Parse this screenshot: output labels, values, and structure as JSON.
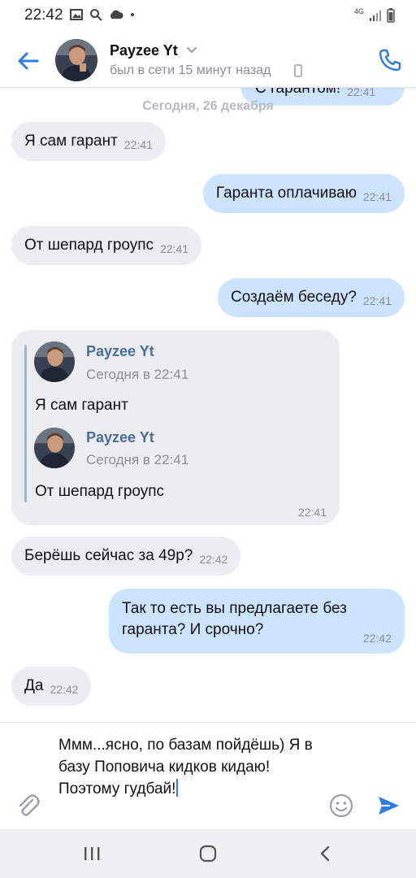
{
  "status_bar": {
    "time": "22:42",
    "network": "4G"
  },
  "header": {
    "name": "Payzee Yt",
    "status": "был в сети 15 минут назад"
  },
  "chat": {
    "partial_message": {
      "text": "С гарантом!",
      "time": "22:41"
    },
    "date_separator": "Сегодня, 26 декабря",
    "messages": [
      {
        "dir": "in",
        "text": "Я сам гарант",
        "time": "22:41"
      },
      {
        "dir": "out",
        "text": "Гаранта оплачиваю",
        "time": "22:41"
      },
      {
        "dir": "in",
        "text": "От шепард гроупс",
        "time": "22:41"
      },
      {
        "dir": "out",
        "text": "Создаём беседу?",
        "time": "22:41"
      }
    ],
    "forwarded": {
      "time": "22:41",
      "items": [
        {
          "author": "Payzee Yt",
          "date": "Сегодня в 22:41",
          "text": "Я сам гарант"
        },
        {
          "author": "Payzee Yt",
          "date": "Сегодня в 22:41",
          "text": "От шепард гроупс"
        }
      ]
    },
    "messages_after": [
      {
        "dir": "in",
        "text": "Берёшь сейчас за 49р?",
        "time": "22:42"
      },
      {
        "dir": "out",
        "text": "Так то есть вы предлагаете без гаранта? И срочно?",
        "time": "22:42"
      },
      {
        "dir": "in",
        "text": "Да",
        "time": "22:42"
      }
    ]
  },
  "composer": {
    "value": "Ммм...ясно, по базам пойдёшь) Я в базу Поповича кидков кидаю! Поэтому гудбай!"
  },
  "colors": {
    "accent": "#2b7de9",
    "incoming_bubble": "#ebedf0",
    "outgoing_bubble": "#cce4ff",
    "author_name": "#4a6d99"
  },
  "icons": {
    "back": "arrow-left-icon",
    "call": "phone-icon",
    "attach": "paperclip-icon",
    "emoji": "smiley-icon",
    "send": "send-icon"
  }
}
